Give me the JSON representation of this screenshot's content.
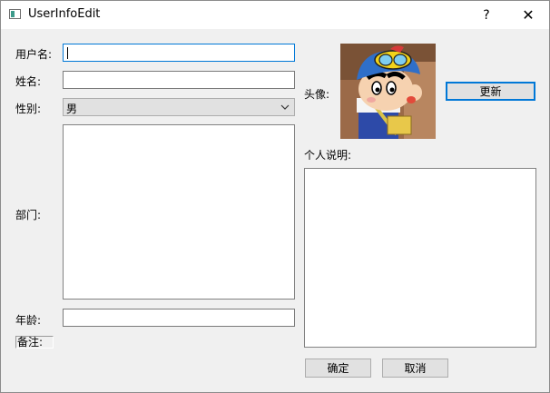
{
  "window": {
    "title": "UserInfoEdit",
    "help_glyph": "?",
    "close_glyph": "✕"
  },
  "form": {
    "username_label": "用户名:",
    "username_value": "",
    "name_label": "姓名:",
    "name_value": "",
    "gender_label": "性别:",
    "gender_value": "男",
    "department_label": "部门:",
    "age_label": "年龄:",
    "age_value": "",
    "remark_label": "备注:"
  },
  "profile": {
    "avatar_label": "头像:",
    "update_button": "更新",
    "description_label": "个人说明:"
  },
  "actions": {
    "ok_button": "确定",
    "cancel_button": "取消"
  },
  "colors": {
    "focus_border": "#0078d7",
    "window_bg": "#f0f0f0"
  }
}
